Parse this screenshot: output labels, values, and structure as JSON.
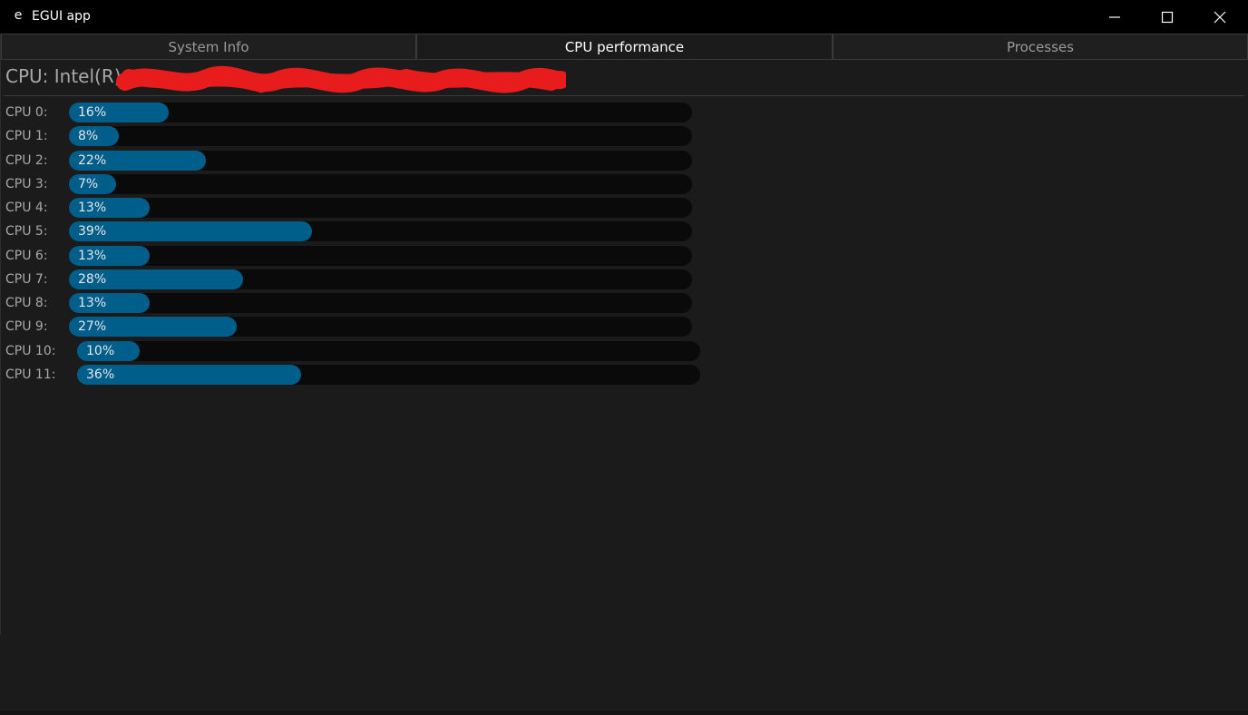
{
  "window": {
    "icon": "e",
    "title": "EGUI app",
    "controls": {
      "minimize": "minimize-icon",
      "maximize": "maximize-icon",
      "close": "close-icon"
    }
  },
  "tabs": [
    {
      "label": "System Info",
      "active": false
    },
    {
      "label": "CPU performance",
      "active": true
    },
    {
      "label": "Processes",
      "active": false
    }
  ],
  "cpu_header": "CPU: Intel(R)",
  "cpus": [
    {
      "label": "CPU 0:",
      "usage": 16,
      "text": "16%"
    },
    {
      "label": "CPU 1:",
      "usage": 8,
      "text": "8%"
    },
    {
      "label": "CPU 2:",
      "usage": 22,
      "text": "22%"
    },
    {
      "label": "CPU 3:",
      "usage": 7,
      "text": "7%"
    },
    {
      "label": "CPU 4:",
      "usage": 13,
      "text": "13%"
    },
    {
      "label": "CPU 5:",
      "usage": 39,
      "text": "39%"
    },
    {
      "label": "CPU 6:",
      "usage": 13,
      "text": "13%"
    },
    {
      "label": "CPU 7:",
      "usage": 28,
      "text": "28%"
    },
    {
      "label": "CPU 8:",
      "usage": 13,
      "text": "13%"
    },
    {
      "label": "CPU 9:",
      "usage": 27,
      "text": "27%"
    },
    {
      "label": "CPU 10:",
      "usage": 10,
      "text": "10%"
    },
    {
      "label": "CPU 11:",
      "usage": 36,
      "text": "36%"
    }
  ],
  "colors": {
    "bar_fill": "#005e8b",
    "bar_track": "#0a0a0a",
    "background": "#1b1b1b",
    "titlebar": "#000000",
    "redaction": "#e81c1c"
  }
}
